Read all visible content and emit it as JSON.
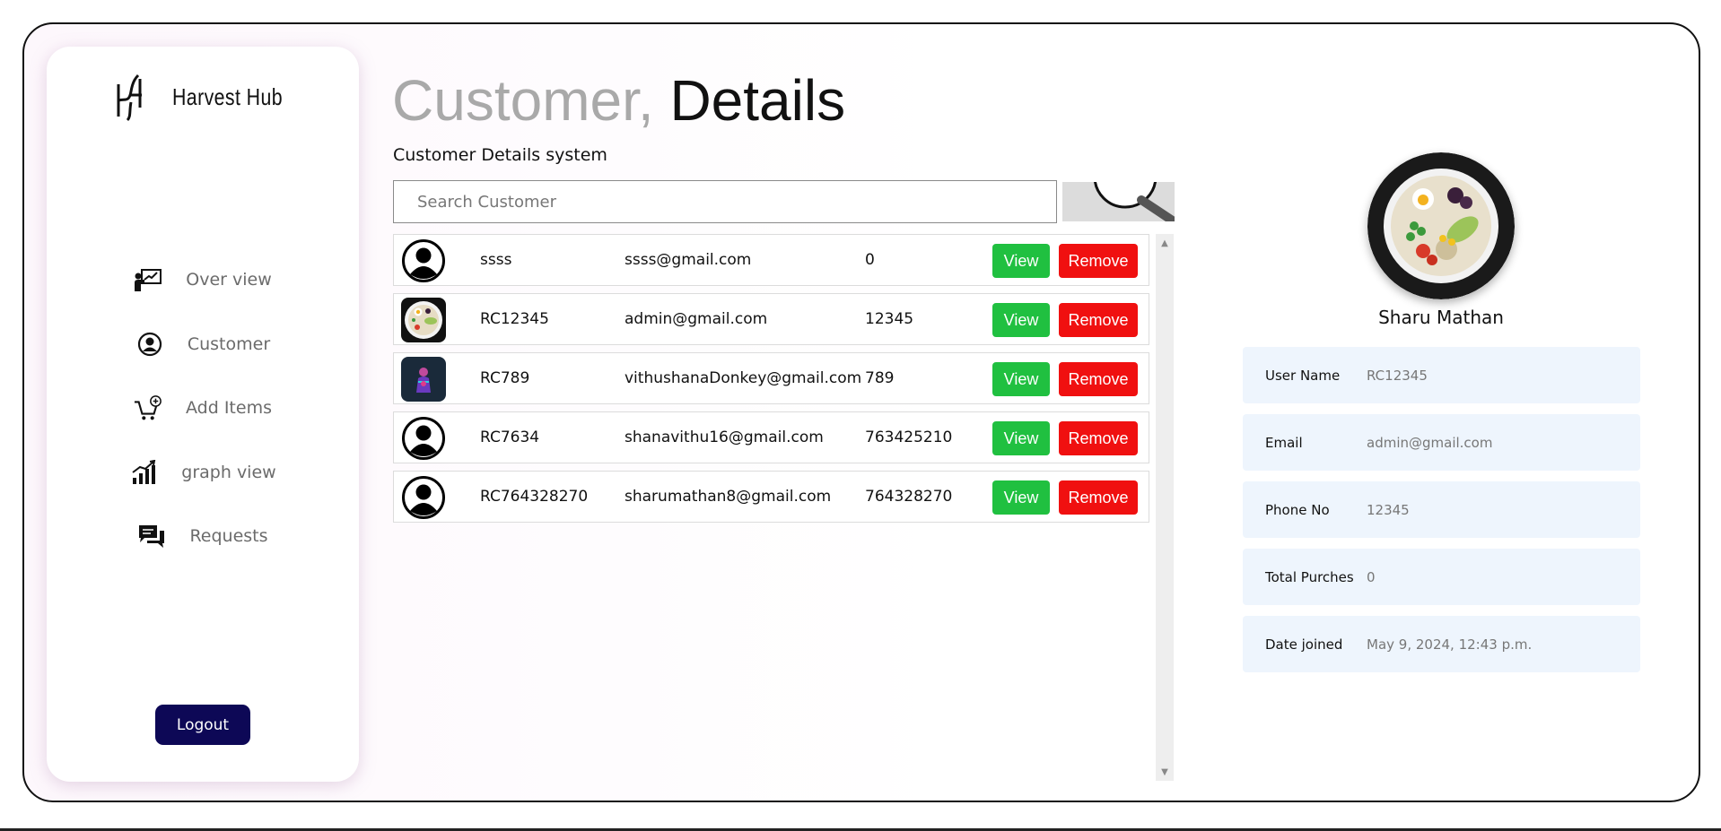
{
  "app": {
    "name": "Harvest Hub"
  },
  "sidebar": {
    "items": [
      {
        "label": "Over view",
        "icon": "presentation-chart-icon"
      },
      {
        "label": "Customer",
        "icon": "user-circle-icon"
      },
      {
        "label": "Add Items",
        "icon": "cart-plus-icon"
      },
      {
        "label": "graph view",
        "icon": "bar-growth-icon"
      },
      {
        "label": "Requests",
        "icon": "chat-bubbles-icon"
      }
    ],
    "logout_label": "Logout"
  },
  "header": {
    "title_prefix": "Customer,",
    "title_main": "Details",
    "subtitle": "Customer Details system"
  },
  "search": {
    "placeholder": "Search Customer",
    "value": ""
  },
  "customers": [
    {
      "avatar": "default-user",
      "id": "ssss",
      "email": "ssss@gmail.com",
      "phone": "0"
    },
    {
      "avatar": "food-bowl",
      "id": "RC12345",
      "email": "admin@gmail.com",
      "phone": "12345"
    },
    {
      "avatar": "purple-figure",
      "id": "RC789",
      "email": "vithushanaDonkey@gmail.com",
      "phone": "789"
    },
    {
      "avatar": "default-user",
      "id": "RC7634",
      "email": "shanavithu16@gmail.com",
      "phone": "763425210"
    },
    {
      "avatar": "default-user",
      "id": "RC764328270",
      "email": "sharumathan8@gmail.com",
      "phone": "764328270"
    }
  ],
  "row_actions": {
    "view_label": "View",
    "remove_label": "Remove"
  },
  "profile": {
    "name": "Sharu Mathan",
    "fields": [
      {
        "label": "User Name",
        "value": "RC12345"
      },
      {
        "label": "Email",
        "value": "admin@gmail.com"
      },
      {
        "label": "Phone No",
        "value": "12345"
      },
      {
        "label": "Total Purches",
        "value": "0"
      },
      {
        "label": "Date joined",
        "value": "May 9, 2024, 12:43 p.m."
      }
    ]
  },
  "colors": {
    "view_button": "#20c040",
    "remove_button": "#f01010",
    "logout_button": "#0d0856",
    "info_card": "#eef5fd"
  }
}
